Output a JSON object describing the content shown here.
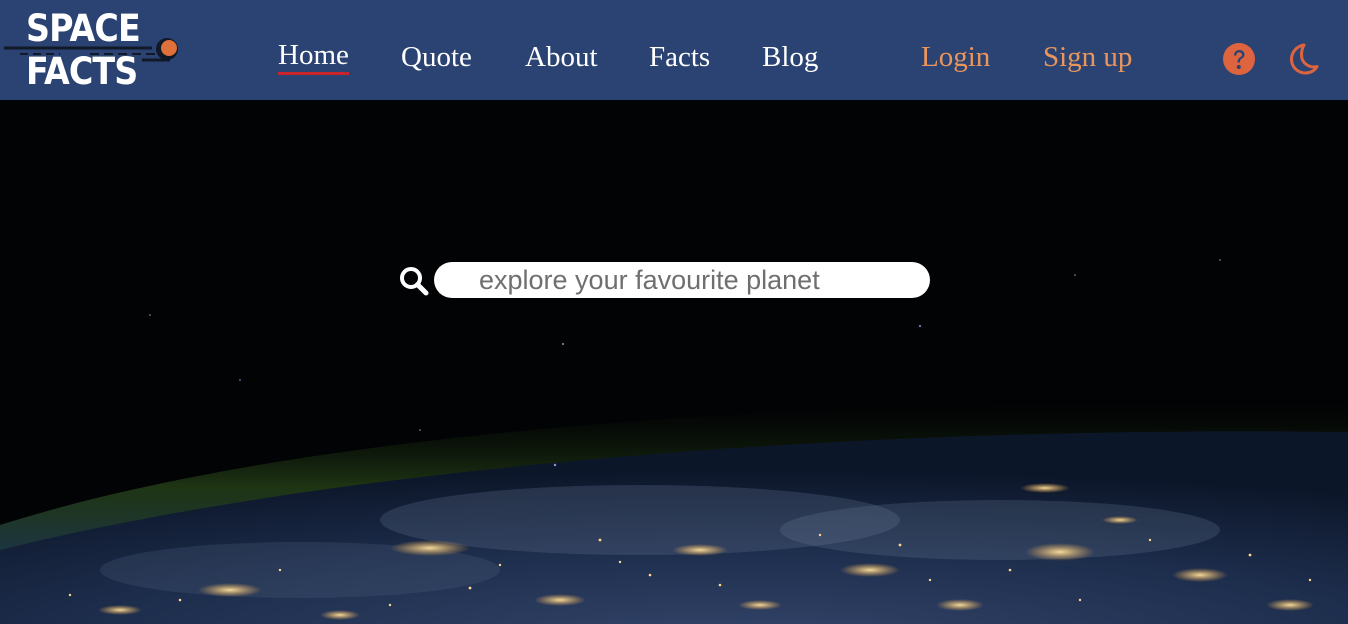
{
  "brand": {
    "line1": "SPACE",
    "line2": "FACTS"
  },
  "nav": {
    "links": [
      {
        "label": "Home",
        "active": true
      },
      {
        "label": "Quote",
        "active": false
      },
      {
        "label": "About",
        "active": false
      },
      {
        "label": "Facts",
        "active": false
      },
      {
        "label": "Blog",
        "active": false
      }
    ],
    "auth": {
      "login": "Login",
      "signup": "Sign up"
    },
    "icons": [
      "help-circle-icon",
      "moon-icon"
    ]
  },
  "search": {
    "placeholder": "explore your favourite planet",
    "value": ""
  },
  "hero": {
    "image": "earth-at-night-from-orbit"
  },
  "colors": {
    "navbar": "#2b4372",
    "nav_text": "#ffffff",
    "auth_text": "#e9955c",
    "active_underline": "#c8252b",
    "icon_accent": "#de6440",
    "background": "#000000"
  }
}
